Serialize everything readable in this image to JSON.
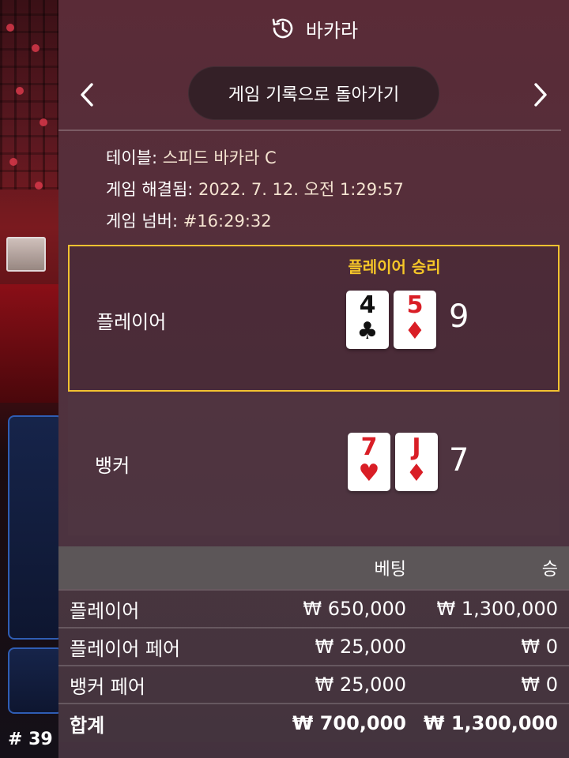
{
  "header": {
    "title": "바카라",
    "history_icon": "history-icon"
  },
  "nav": {
    "back_label": "게임 기록으로 돌아가기",
    "prev_icon": "chevron-left-icon",
    "next_icon": "chevron-right-icon"
  },
  "info": {
    "table_label": "테이블:",
    "table_value": "스피드 바카라 C",
    "resolved_label": "게임 해결됨:",
    "resolved_value": "2022. 7. 12. 오전 1:29:57",
    "number_label": "게임 넘버:",
    "number_value": "#16:29:32"
  },
  "player": {
    "label": "플레이어",
    "win_label": "플레이어 승리",
    "total": "9",
    "cards": [
      {
        "rank": "4",
        "suit": "♣",
        "color": "black"
      },
      {
        "rank": "5",
        "suit": "♦",
        "color": "red"
      }
    ]
  },
  "banker": {
    "label": "뱅커",
    "total": "7",
    "cards": [
      {
        "rank": "7",
        "suit": "♥",
        "color": "red"
      },
      {
        "rank": "J",
        "suit": "♦",
        "color": "red"
      }
    ]
  },
  "bets": {
    "headers": {
      "bet": "베팅",
      "win": "승"
    },
    "rows": [
      {
        "name": "플레이어",
        "bet": "₩ 650,000",
        "win": "₩ 1,300,000"
      },
      {
        "name": "플레이어 페어",
        "bet": "₩ 25,000",
        "win": "₩ 0"
      },
      {
        "name": "뱅커 페어",
        "bet": "₩ 25,000",
        "win": "₩ 0"
      }
    ],
    "total": {
      "name": "합계",
      "bet": "₩ 700,000",
      "win": "₩ 1,300,000"
    }
  },
  "side": {
    "round_number": "# 39"
  },
  "colors": {
    "highlight": "#f2c230",
    "win_text": "#f5c628",
    "card_red": "#d91e26"
  }
}
